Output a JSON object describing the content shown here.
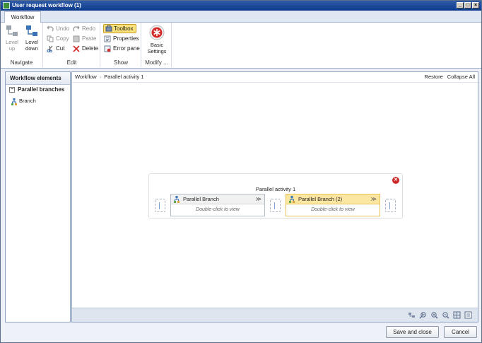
{
  "window": {
    "title": "User request workflow (1)",
    "controls": [
      "_",
      "□",
      "×"
    ]
  },
  "ribbon": {
    "tab": "Workflow",
    "groups": {
      "navigate": {
        "label": "Navigate",
        "level_up": [
          "Level",
          "up"
        ],
        "level_down": [
          "Level",
          "down"
        ]
      },
      "edit": {
        "label": "Edit",
        "undo": "Undo",
        "redo": "Redo",
        "copy": "Copy",
        "paste": "Paste",
        "cut": "Cut",
        "delete": "Delete"
      },
      "show": {
        "label": "Show",
        "toolbox": "Toolbox",
        "properties": "Properties",
        "error_pane": "Error pane"
      },
      "modify": {
        "label": "Modify ...",
        "basic_settings": [
          "Basic",
          "Settings"
        ]
      }
    }
  },
  "elements_pane": {
    "header": "Workflow elements",
    "group": "Parallel branches",
    "collapse_glyph": "−",
    "items": [
      "Branch"
    ]
  },
  "designer": {
    "breadcrumb": [
      "Workflow",
      "Parallel activity 1"
    ],
    "breadcrumb_sep": "›",
    "actions": {
      "restore": "Restore",
      "collapse_all": "Collapse All"
    },
    "activity": {
      "title": "Parallel activity 1",
      "close_glyph": "✕",
      "branches": [
        {
          "name": "Parallel Branch",
          "hint": "Double-click to view",
          "chevron": "≫"
        },
        {
          "name": "Parallel Branch (2)",
          "hint": "Double-click to view",
          "chevron": "≫"
        }
      ]
    }
  },
  "footer": {
    "save_close": "Save and close",
    "cancel": "Cancel"
  },
  "colors": {
    "title_bar": "#0c3a8c",
    "selected_branch": "#fbe6a2",
    "toolbox_active": "#fce27a",
    "close_red": "#cc2a2a"
  }
}
